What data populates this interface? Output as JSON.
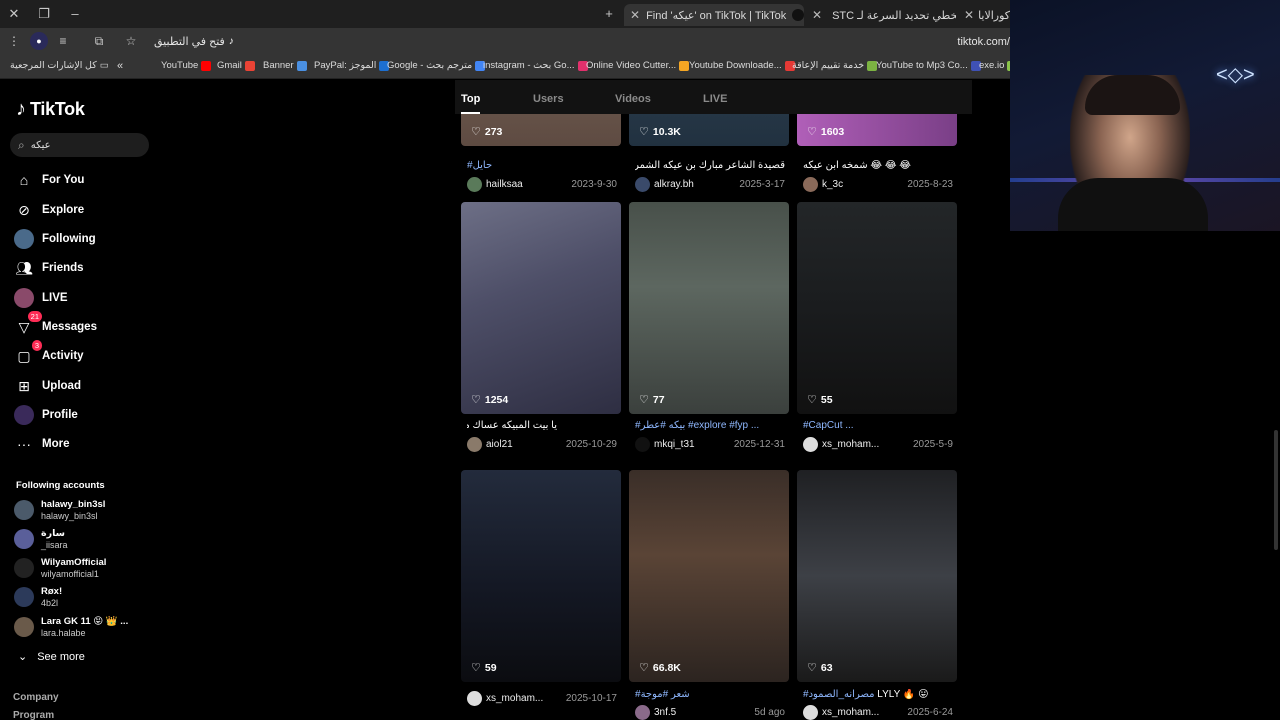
{
  "browser": {
    "tabs": [
      {
        "title": "Find 'عيكه' on TikTok | TikTok",
        "active": true
      },
      {
        "title": "STC تخطي تحديد السرعة لـ"
      },
      {
        "title": "ك كورالايا | Tube"
      }
    ],
    "url_open_label": "فتح في التطبيق",
    "url": "tiktok.com/",
    "bookmarks_folder": "كل الإشارات المرجعية",
    "bookmarks": [
      {
        "label": "YouTube",
        "color": "#ff0000"
      },
      {
        "label": "Gmail",
        "color": "#ea4335"
      },
      {
        "label": "Banner",
        "color": "#4a90e2"
      },
      {
        "label": "PayPal: الموجز",
        "color": "#1c6fd1"
      },
      {
        "label": "Google - مترجم بحث",
        "color": "#4285f4"
      },
      {
        "label": "instagram - بحث Go...",
        "color": "#e1306c"
      },
      {
        "label": "Online Video Cutter...",
        "color": "#f5a623"
      },
      {
        "label": "Youtube Downloade...",
        "color": "#e53935"
      },
      {
        "label": "خدمة تقييم الإعاقة",
        "color": "#7cb342"
      },
      {
        "label": "YouTube to Mp3 Co...",
        "color": "#3f51b5"
      },
      {
        "label": "exe.io",
        "color": "#8bc34a"
      }
    ]
  },
  "tiktok": {
    "logo_text": "TikTok",
    "search_value": "عيكه",
    "nav": [
      {
        "label": "For You",
        "icon": "home-icon"
      },
      {
        "label": "Explore",
        "icon": "compass-icon"
      },
      {
        "label": "Following",
        "icon": "following-avatar-icon"
      },
      {
        "label": "Friends",
        "icon": "friends-icon"
      },
      {
        "label": "LIVE",
        "icon": "live-avatar-icon"
      },
      {
        "label": "Messages",
        "icon": "messages-icon",
        "badge": "21"
      },
      {
        "label": "Activity",
        "icon": "activity-icon",
        "badge": "3"
      },
      {
        "label": "Upload",
        "icon": "upload-icon"
      },
      {
        "label": "Profile",
        "icon": "profile-icon"
      },
      {
        "label": "More",
        "icon": "more-icon"
      }
    ],
    "following_heading": "Following accounts",
    "following_accounts": [
      {
        "display": "halawy_bin3sl",
        "user": "halawy_bin3sl"
      },
      {
        "display": "سارة",
        "user": "_iisara"
      },
      {
        "display": "WilyamOfficial",
        "user": "wilyamofficial1"
      },
      {
        "display": "Røx!",
        "user": "4b2l"
      },
      {
        "display": "Lara GK 11 😝 👑 ...",
        "user": "lara.halabe"
      }
    ],
    "see_more": "See more",
    "footer": [
      "Company",
      "Program"
    ]
  },
  "results": {
    "tabs": [
      "Top",
      "Users",
      "Videos",
      "LIVE"
    ],
    "active_tab": "Top",
    "rows": [
      [
        {
          "likes": "273",
          "caption_tag": "#حايل",
          "caption": "",
          "user": "hailksaa",
          "date": "2023-9-30"
        },
        {
          "likes": "10.3K",
          "caption_tag": "",
          "caption": "قصيدة الشاعر مبارك بن عيكه الشمري ...",
          "user": "alkray.bh",
          "date": "2025-3-17"
        },
        {
          "likes": "1603",
          "caption_tag": "",
          "caption": "😂 😂 😂 شمخه ابن عيكه",
          "user": "k_3c",
          "date": "2025-8-23"
        }
      ],
      [
        {
          "likes": "1254",
          "caption_tag": "",
          "caption": "يا بيت المبيكه عساك معمر",
          "user": "aiol21",
          "date": "2025-10-29"
        },
        {
          "likes": "77",
          "caption_tag": "#بيكه #عطر #explore #fyp ...",
          "caption": "",
          "user": "mkqi_t31",
          "date": "2025-12-31"
        },
        {
          "likes": "55",
          "caption_tag": "#CapCut ...",
          "caption": "",
          "user": "xs_moham...",
          "date": "2025-5-9"
        }
      ],
      [
        {
          "likes": "59",
          "caption_tag": "",
          "caption": "",
          "user": "xs_moham...",
          "date": "2025-10-17"
        },
        {
          "likes": "66.8K",
          "caption_tag": "#شعر #موجة",
          "caption": "",
          "user": "3nf.5",
          "date": "5d ago"
        },
        {
          "likes": "63",
          "caption_tag": "#مصرانه_الصمود",
          "caption": "LYLY 🔥 😛",
          "user": "xs_moham...",
          "date": "2025-6-24"
        }
      ]
    ]
  },
  "colors": {
    "accent": "#fe2c55",
    "hashtag": "#8fb8ff"
  }
}
